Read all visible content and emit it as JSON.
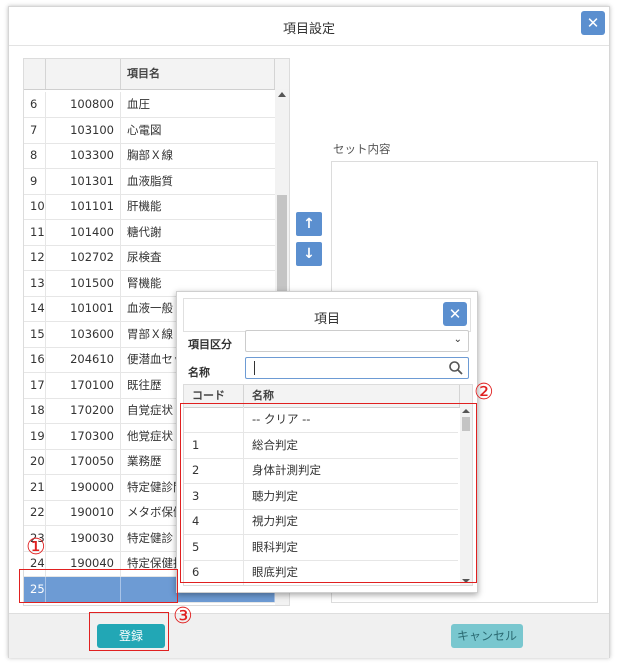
{
  "dialog": {
    "title": "項目設定",
    "close_icon": "✕"
  },
  "grid": {
    "headers": {
      "idx": "",
      "code": "",
      "name": "項目名"
    },
    "rows": [
      {
        "idx": "6",
        "code": "100800",
        "name": "血圧"
      },
      {
        "idx": "7",
        "code": "103100",
        "name": "心電図"
      },
      {
        "idx": "8",
        "code": "103300",
        "name": "胸部Ｘ線"
      },
      {
        "idx": "9",
        "code": "101301",
        "name": "血液脂質"
      },
      {
        "idx": "10",
        "code": "101101",
        "name": "肝機能"
      },
      {
        "idx": "11",
        "code": "101400",
        "name": "糖代謝"
      },
      {
        "idx": "12",
        "code": "102702",
        "name": "尿検査"
      },
      {
        "idx": "13",
        "code": "101500",
        "name": "腎機能"
      },
      {
        "idx": "14",
        "code": "101001",
        "name": "血液一般"
      },
      {
        "idx": "15",
        "code": "103600",
        "name": "胃部Ｘ線"
      },
      {
        "idx": "16",
        "code": "204610",
        "name": "便潜血セット"
      },
      {
        "idx": "17",
        "code": "170100",
        "name": "既往歴"
      },
      {
        "idx": "18",
        "code": "170200",
        "name": "自覚症状"
      },
      {
        "idx": "19",
        "code": "170300",
        "name": "他覚症状"
      },
      {
        "idx": "20",
        "code": "170050",
        "name": "業務歴"
      },
      {
        "idx": "21",
        "code": "190000",
        "name": "特定健診問診"
      },
      {
        "idx": "22",
        "code": "190010",
        "name": "メタボ保健指導"
      },
      {
        "idx": "23",
        "code": "190030",
        "name": "特定健診"
      },
      {
        "idx": "24",
        "code": "190040",
        "name": "特定保健指導"
      },
      {
        "idx": "25",
        "code": "",
        "name": ""
      }
    ],
    "selected_row": "25"
  },
  "move_buttons": {
    "up": "↑",
    "down": "↓"
  },
  "set_panel": {
    "label": "セット内容"
  },
  "footer": {
    "save_label": "登録",
    "cancel_label": "キャンセル"
  },
  "popup": {
    "title": "項目",
    "close_icon": "✕",
    "category_label": "項目区分",
    "category_value": "",
    "name_label": "名称",
    "name_value": "",
    "headers": {
      "code": "コード",
      "name": "名称"
    },
    "rows": [
      {
        "code": "",
        "name": "-- クリア --"
      },
      {
        "code": "1",
        "name": "総合判定"
      },
      {
        "code": "2",
        "name": "身体計測判定"
      },
      {
        "code": "3",
        "name": "聴力判定"
      },
      {
        "code": "4",
        "name": "視力判定"
      },
      {
        "code": "5",
        "name": "眼科判定"
      },
      {
        "code": "6",
        "name": "眼底判定"
      }
    ]
  },
  "annotations": {
    "n1": "①",
    "n2": "②",
    "n3": "③"
  },
  "colors": {
    "accent": "#5b8fcf",
    "save": "#22a7b5",
    "cancel": "#79c7cf",
    "selected_row": "#6d9bd4",
    "annotation": "#e02020"
  }
}
